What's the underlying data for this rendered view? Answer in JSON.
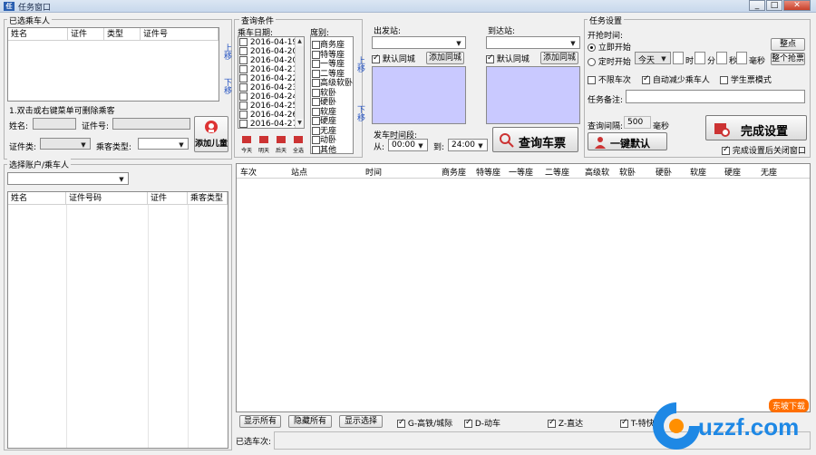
{
  "window": {
    "title": "任务窗口"
  },
  "passengers": {
    "group_title": "已选乘车人",
    "columns": [
      "姓名",
      "证件",
      "类型",
      "证件号"
    ],
    "up": "上移",
    "down": "下移",
    "hint": "1.双击或右键菜单可删除乘客",
    "name_label": "姓名:",
    "id_label": "证件号:",
    "idtype_label": "证件类:",
    "type_label": "乘客类型:",
    "add_child": "添加儿童"
  },
  "query": {
    "group_title": "查询条件",
    "date_label": "乘车日期:",
    "dates": [
      "2016-04-19",
      "2016-04-20",
      "2016-04-20",
      "2016-04-21",
      "2016-04-22",
      "2016-04-23",
      "2016-04-24",
      "2016-04-25",
      "2016-04-26",
      "2016-04-27"
    ],
    "seat_label": "席别:",
    "seats": [
      "商务座",
      "特等座",
      "一等座",
      "二等座",
      "高级软卧",
      "软卧",
      "硬卧",
      "软座",
      "硬座",
      "无座",
      "动卧",
      "其他"
    ],
    "seat_up": "上移",
    "seat_down": "下移",
    "mini_buttons": [
      "今天",
      "明天",
      "后天",
      "全选"
    ]
  },
  "stations": {
    "from_label": "出发站:",
    "to_label": "到达站:",
    "default_from": "默认同城",
    "add_from": "添加同城",
    "default_to": "默认同城",
    "add_to": "添加同城",
    "time_label": "发车时间段:",
    "from_time_label": "从:",
    "from_time": "00:00",
    "to_time_label": "到:",
    "to_time": "24:00",
    "query_btn": "查询车票"
  },
  "task": {
    "group_title": "任务设置",
    "start_label": "开抢时间:",
    "now": "立即开始",
    "timed": "定时开始",
    "day_combo": "今天",
    "h": "时",
    "m": "分",
    "s": "秒",
    "ms": "毫秒",
    "at_point": "整点",
    "at_point_sec": "整个抢票",
    "no_split": "不限车次",
    "auto_reduce": "自动减少乘车人",
    "student": "学生票模式",
    "remark_label": "任务备注:",
    "interval_label": "查询间隔:",
    "interval_val": "500",
    "interval_unit": "毫秒",
    "one_default": "一键默认",
    "finish": "完成设置",
    "close_after": "完成设置后关闭窗口"
  },
  "contacts": {
    "group_title": "选择账户/乘车人",
    "columns": [
      "姓名",
      "证件号码",
      "证件",
      "乘客类型"
    ]
  },
  "trains": {
    "columns": [
      "车次",
      "站点",
      "时间",
      "商务座",
      "特等座",
      "一等座",
      "二等座",
      "高级软",
      "软卧",
      "硬卧",
      "软座",
      "硬座",
      "无座"
    ]
  },
  "bottom": {
    "show_all": "显示所有",
    "hide_all": "隐藏所有",
    "show_filter": "显示选择",
    "types": [
      "G-高铁/城际",
      "D-动车",
      "Z-直达",
      "T-特快"
    ],
    "selected_label": "已选车次:"
  },
  "watermark": {
    "brand": "uzzf.com",
    "tag": "东坡下载"
  }
}
